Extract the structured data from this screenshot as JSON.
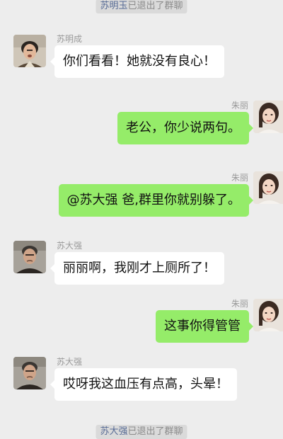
{
  "system_top": {
    "name": "苏明玉",
    "text": "已退出了群聊"
  },
  "system_bottom": {
    "name": "苏大强",
    "text": "已退出了群聊"
  },
  "messages": [
    {
      "side": "left",
      "sender": "苏明成",
      "text": "你们看看！她就没有良心！",
      "avatar": "man-curly-hair-avatar"
    },
    {
      "side": "right",
      "sender": "朱丽",
      "text": "老公，你少说两句。",
      "avatar": "woman-avatar"
    },
    {
      "side": "right",
      "sender": "朱丽",
      "text": "@苏大强 爸,群里你就别躲了。",
      "avatar": "woman-avatar"
    },
    {
      "side": "left",
      "sender": "苏大强",
      "text": "丽丽啊，我刚才上厕所了！",
      "avatar": "old-man-avatar"
    },
    {
      "side": "right",
      "sender": "朱丽",
      "text": "这事你得管管",
      "avatar": "woman-avatar"
    },
    {
      "side": "left",
      "sender": "苏大强",
      "text": "哎呀我这血压有点高，头晕！",
      "avatar": "old-man-avatar"
    }
  ],
  "colors": {
    "background": "#ededed",
    "sent_bubble": "#95ec69",
    "received_bubble": "#ffffff",
    "link_name": "#576b95"
  }
}
